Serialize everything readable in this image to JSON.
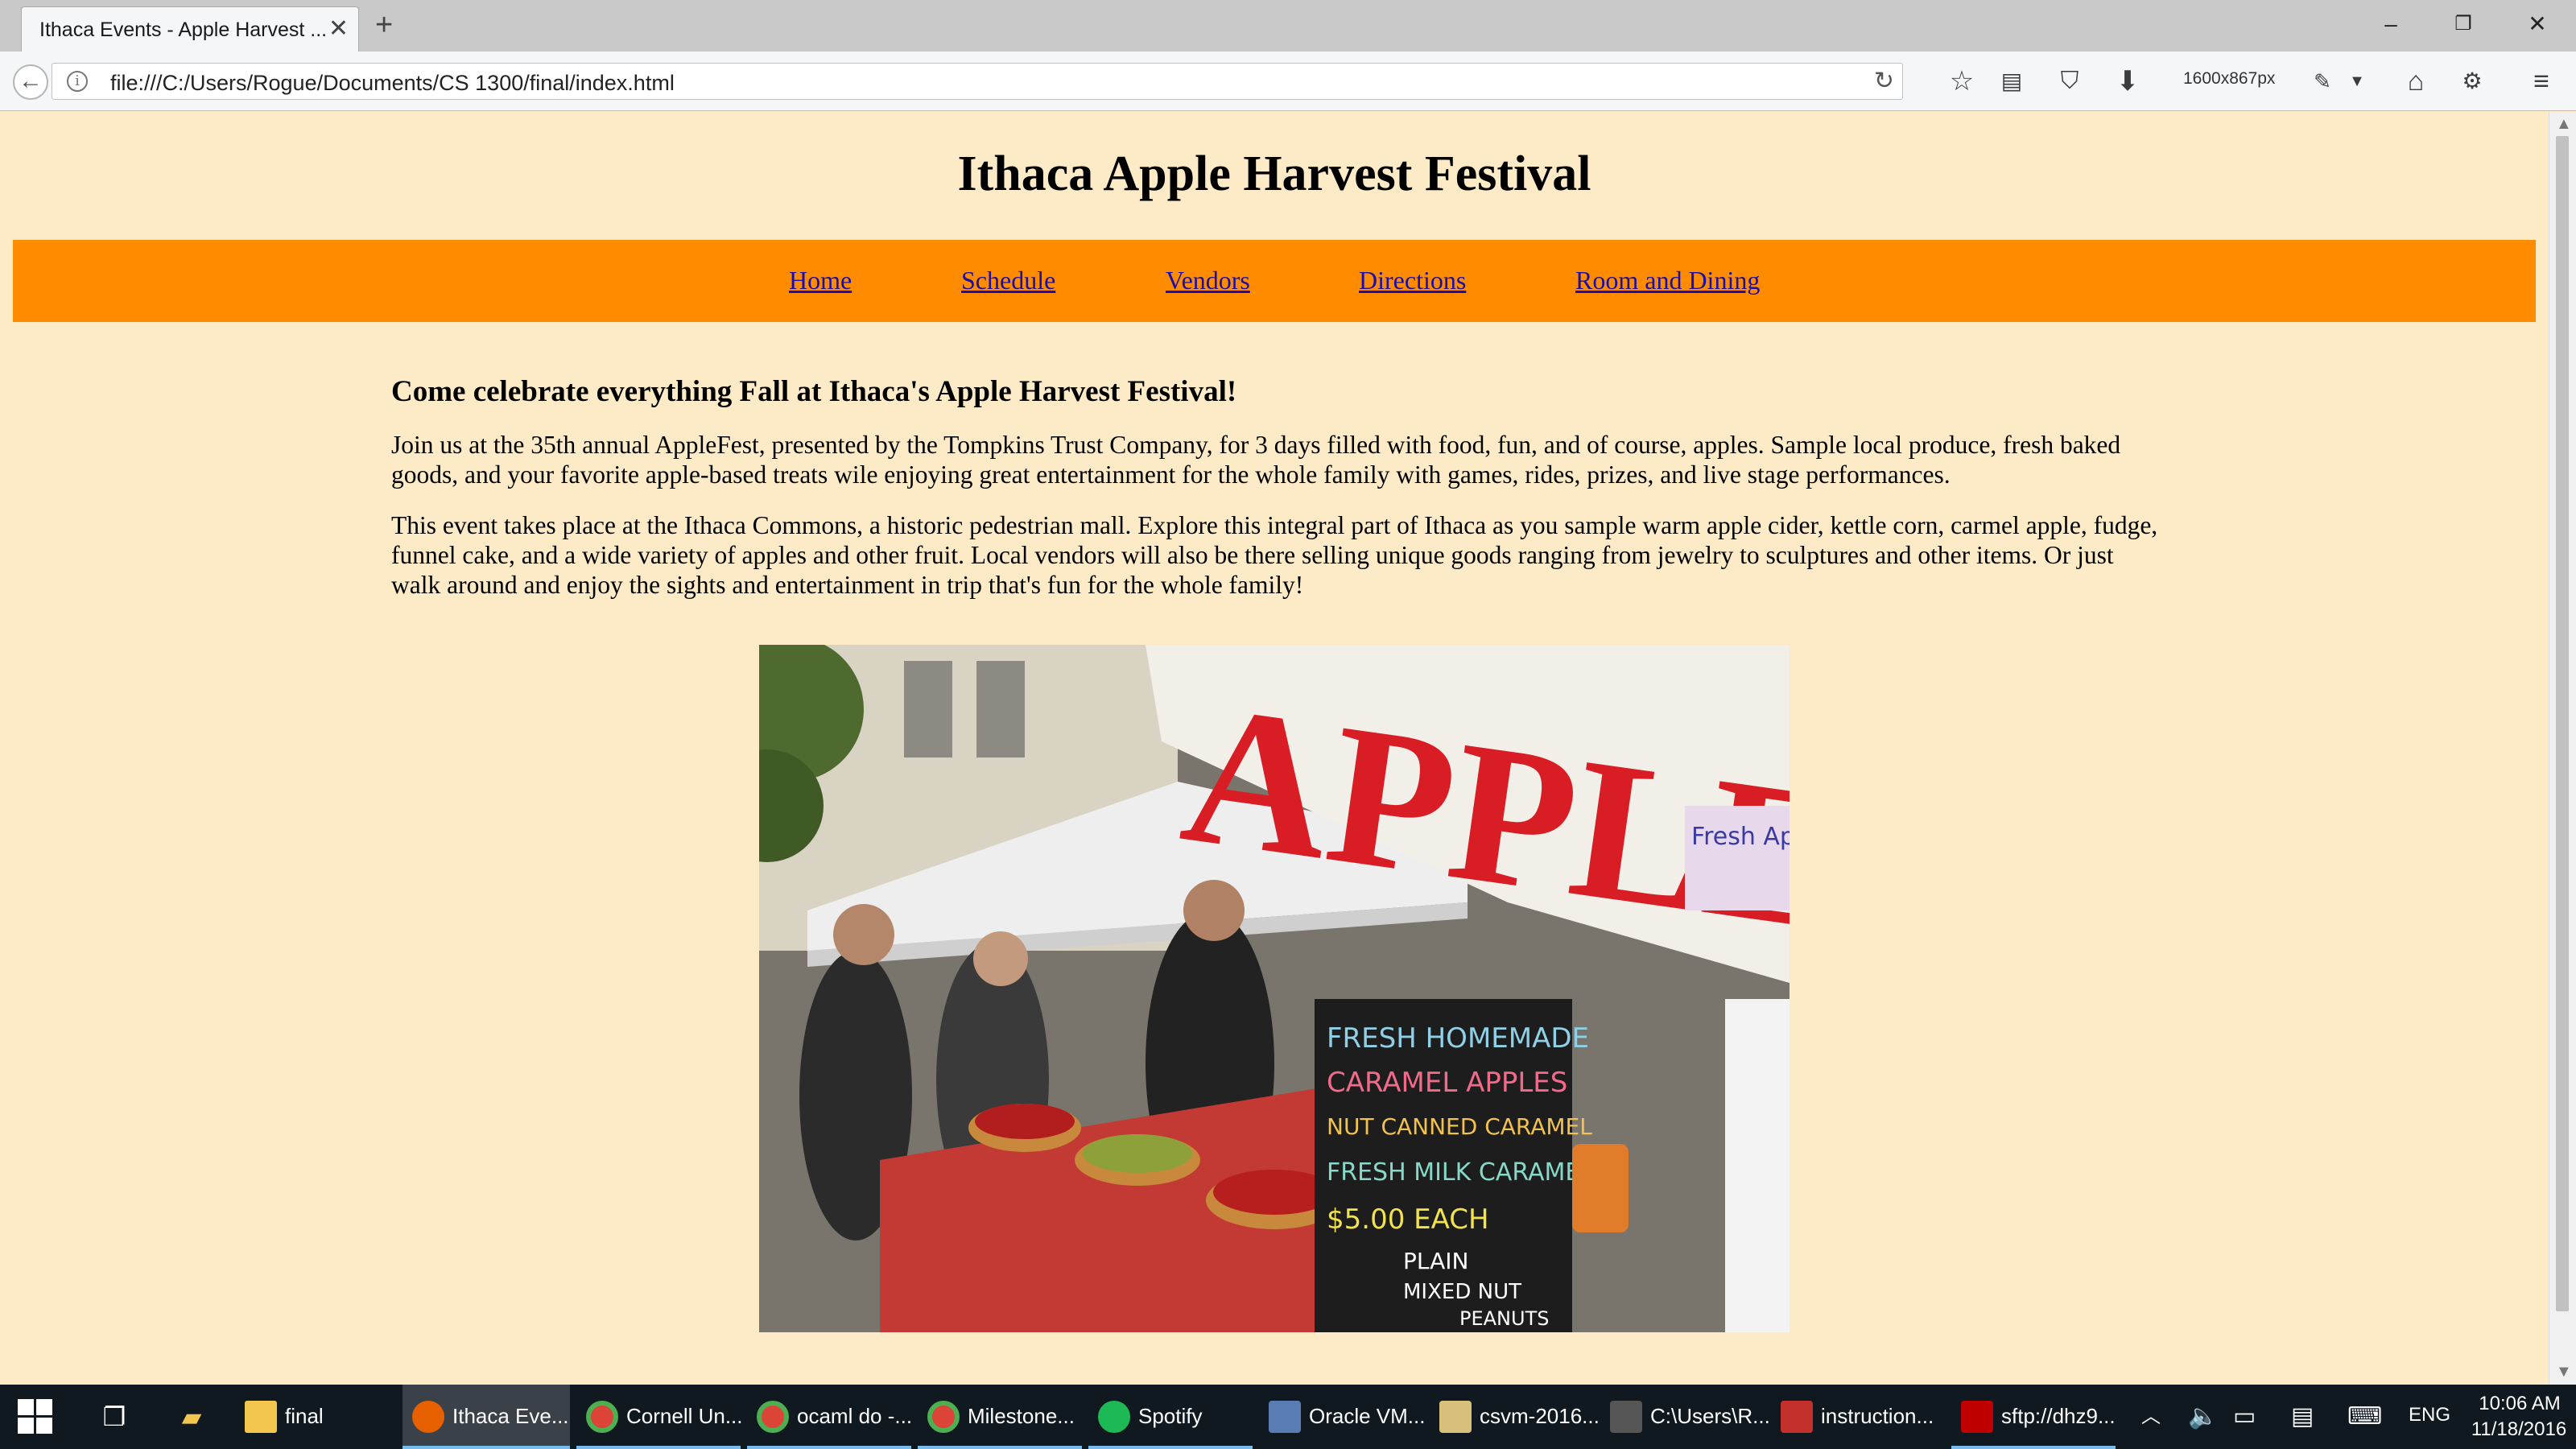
{
  "browser": {
    "tab_title": "Ithaca Events - Apple Harvest ...",
    "url": "file:///C:/Users/Rogue/Documents/CS 1300/final/index.html",
    "dimensions_label": "1600x867px"
  },
  "page": {
    "title": "Ithaca Apple Harvest Festival",
    "nav": [
      {
        "label": "Home"
      },
      {
        "label": "Schedule"
      },
      {
        "label": "Vendors"
      },
      {
        "label": "Directions"
      },
      {
        "label": "Room and Dining"
      }
    ],
    "heading": "Come celebrate everything Fall at Ithaca's Apple Harvest Festival!",
    "paragraphs": [
      "Join us at the 35th annual AppleFest, presented by the Tompkins Trust Company, for 3 days filled with food, fun, and of course, apples. Sample local produce, fresh baked goods, and your favorite apple-based treats wile enjoying great entertainment for the whole family with games, rides, prizes, and live stage performances.",
      "This event takes place at the Ithaca Commons, a historic pedestrian mall. Explore this integral part of Ithaca as you sample warm apple cider, kettle corn, carmel apple, fudge, funnel cake, and a wide variety of apples and other fruit. Local vendors will also be there selling unique goods ranging from jewelry to sculptures and other items. Or just walk around and enjoy the sights and entertainment in trip that's fun for the whole family!"
    ],
    "photo_text": {
      "sign": "APPLES",
      "fresh_sign": "Fresh Apples",
      "chalkboard": [
        "FRESH HOMEMADE",
        "CARAMEL APPLES",
        "NUT CANNED CARAMEL",
        "FRESH MILK CARAMEL",
        "$5.00 EACH",
        "PLAIN",
        "MIXED NUT",
        "PEANUTS"
      ]
    },
    "colors": {
      "background": "#fdebc8",
      "nav_bar": "#ff8c00",
      "link": "#1a0dab"
    }
  },
  "taskbar": {
    "items": [
      {
        "label": "final",
        "icon": "folder-icon"
      },
      {
        "label": "Ithaca Eve...",
        "icon": "firefox-icon"
      },
      {
        "label": "Cornell Un...",
        "icon": "chrome-icon"
      },
      {
        "label": "ocaml do -...",
        "icon": "chrome-icon"
      },
      {
        "label": "Milestone...",
        "icon": "chrome-icon"
      },
      {
        "label": "Spotify",
        "icon": "spotify-icon"
      },
      {
        "label": "Oracle VM...",
        "icon": "virtualbox-icon"
      },
      {
        "label": "csvm-2016...",
        "icon": "archive-icon"
      },
      {
        "label": "C:\\Users\\R...",
        "icon": "terminal-icon"
      },
      {
        "label": "instruction...",
        "icon": "pdf-icon"
      },
      {
        "label": "sftp://dhz9...",
        "icon": "filezilla-icon"
      }
    ],
    "language": "ENG",
    "time": "10:06 AM",
    "date": "11/18/2016"
  }
}
